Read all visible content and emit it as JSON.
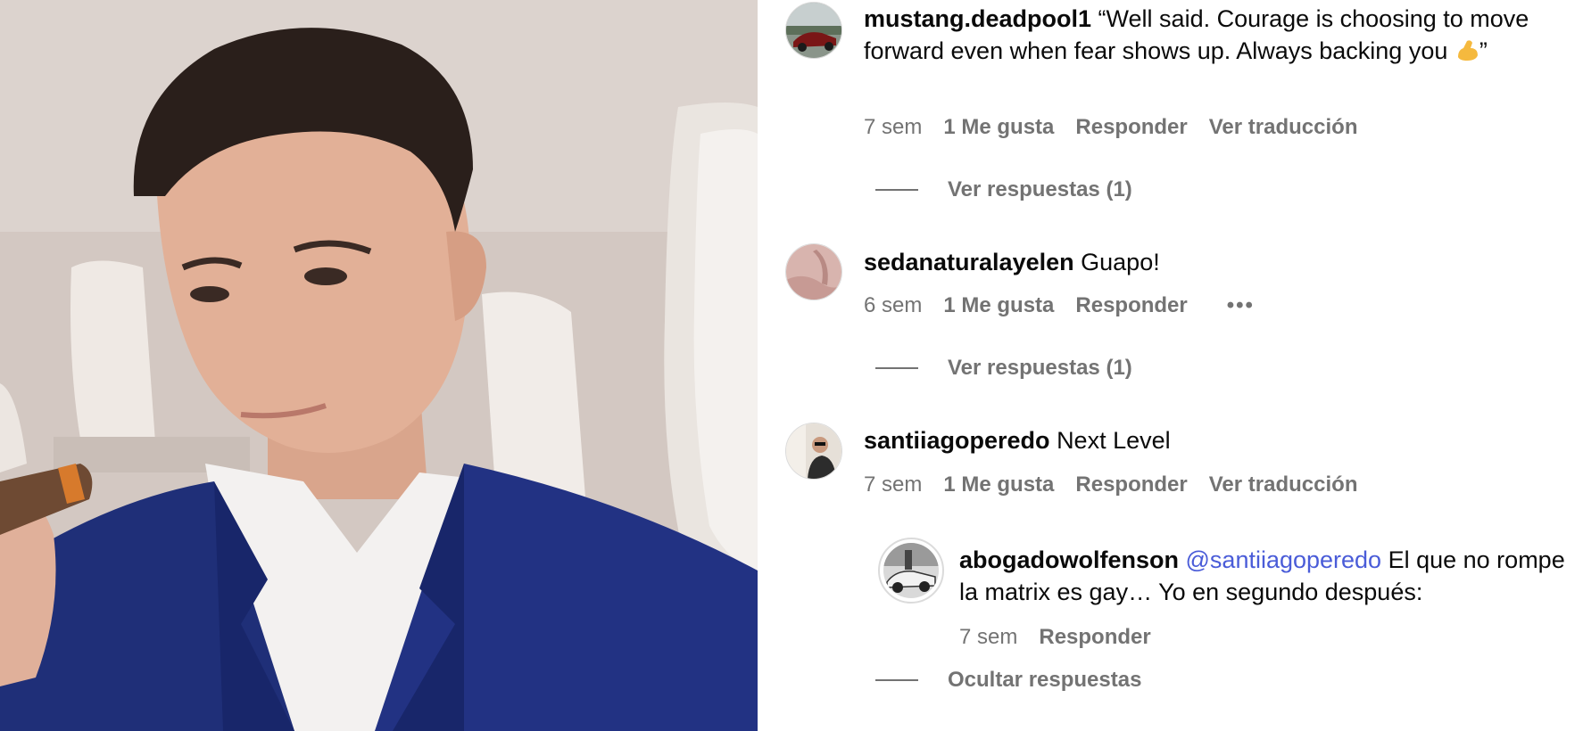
{
  "comments": [
    {
      "username": "mustang.deadpool1",
      "text_before_emoji": "“Well said. Courage is choosing to move forward even when fear shows up. Always backing you ",
      "emoji": "flexed-biceps",
      "text_after_emoji": "”",
      "time": "7 sem",
      "likes": "1 Me gusta",
      "reply_label": "Responder",
      "translate_label": "Ver traducción",
      "thread_label": "Ver respuestas (1)"
    },
    {
      "username": "sedanaturalayelen",
      "text": "Guapo!",
      "time": "6 sem",
      "likes": "1 Me gusta",
      "reply_label": "Responder",
      "more_label": "•••",
      "thread_label": "Ver respuestas (1)"
    },
    {
      "username": "santiiagoperedo",
      "text": "Next Level",
      "time": "7 sem",
      "likes": "1 Me gusta",
      "reply_label": "Responder",
      "translate_label": "Ver traducción"
    }
  ],
  "reply": {
    "username": "abogadowolfenson",
    "mention": "@santiiagoperedo",
    "text": "El que no rompe la matrix es gay… Yo en segundo después:",
    "time": "7 sem",
    "reply_label": "Responder",
    "hide_label": "Ocultar respuestas"
  },
  "colors": {
    "meta_gray": "#737373",
    "mention_blue": "#4a5cd8",
    "text": "#0a0a0a",
    "suit_blue": "#1f2f78"
  }
}
